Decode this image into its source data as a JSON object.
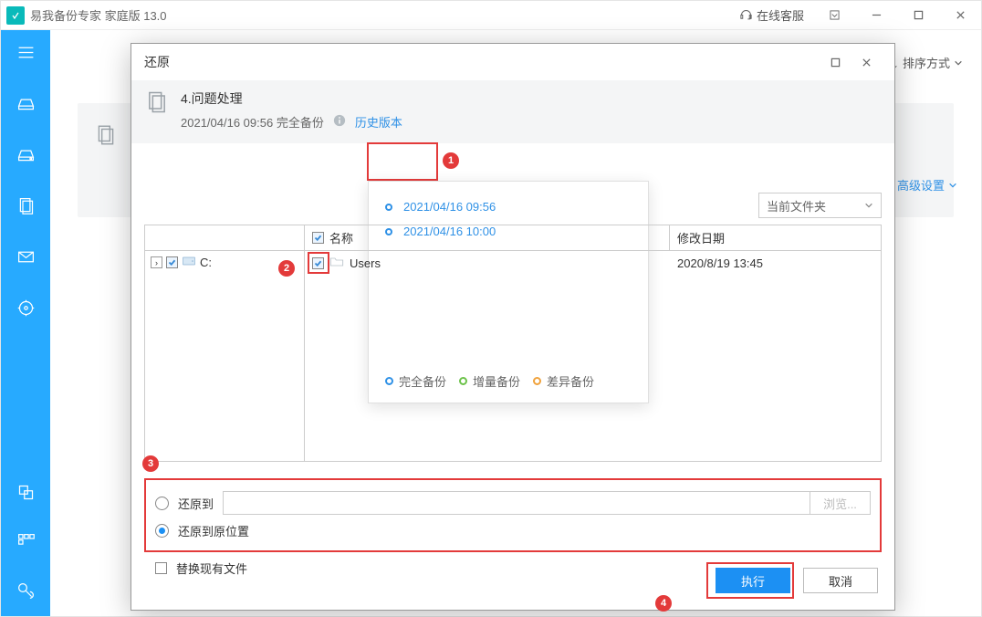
{
  "app": {
    "title": "易我备份专家 家庭版 13.0",
    "online_service": "在线客服"
  },
  "toolbar": {
    "sort": "排序方式"
  },
  "card": {
    "dropdown": "当前文件夹",
    "advanced": "高级设置"
  },
  "dialog": {
    "title": "还原",
    "task_name": "4.问题处理",
    "task_meta": "2021/04/16 09:56 完全备份",
    "history": "历史版本",
    "versions": [
      "2021/04/16 09:56",
      "2021/04/16 10:00"
    ],
    "legend": {
      "full": "完全备份",
      "inc": "增量备份",
      "diff": "差异备份"
    },
    "tree_drive": "C:",
    "col_name": "名称",
    "col_mod": "修改日期",
    "row_folder": "Users",
    "row_date": "2020/8/19 13:45",
    "restore_to": "还原到",
    "restore_orig": "还原到原位置",
    "browse": "浏览...",
    "replace": "替换现有文件",
    "exec": "执行",
    "cancel": "取消"
  },
  "markers": {
    "m1": "1",
    "m2": "2",
    "m3": "3",
    "m4": "4"
  }
}
